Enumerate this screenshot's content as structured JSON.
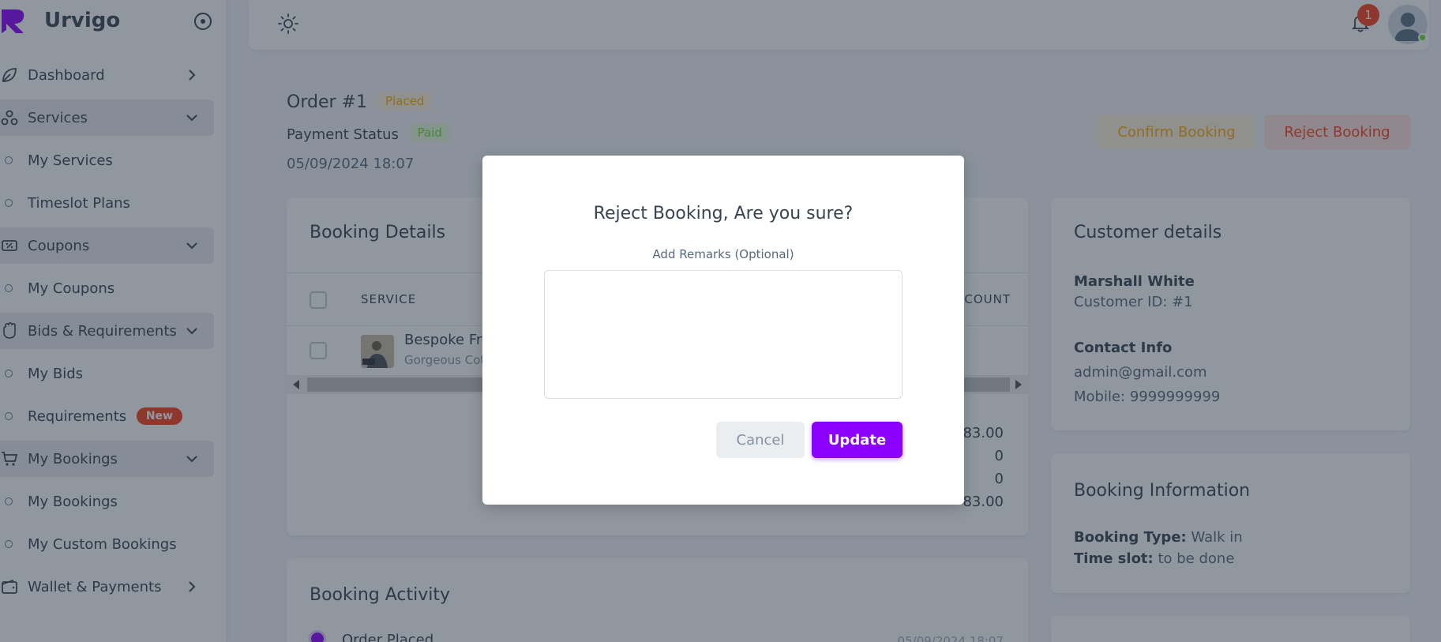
{
  "brand": {
    "name": "Urvigo"
  },
  "sidebar": {
    "items": [
      {
        "type": "menu",
        "label": "Dashboard",
        "icon": "leaf-icon",
        "chevron": "right",
        "open": false
      },
      {
        "type": "menu",
        "label": "Services",
        "icon": "services-icon",
        "chevron": "down",
        "open": true
      },
      {
        "type": "sub",
        "label": "My Services"
      },
      {
        "type": "sub",
        "label": "Timeslot Plans"
      },
      {
        "type": "menu",
        "label": "Coupons",
        "icon": "coupon-icon",
        "chevron": "down",
        "open": true
      },
      {
        "type": "sub",
        "label": "My Coupons"
      },
      {
        "type": "menu",
        "label": "Bids & Requirements",
        "icon": "hand-icon",
        "chevron": "down",
        "open": true
      },
      {
        "type": "sub",
        "label": "My Bids"
      },
      {
        "type": "sub",
        "label": "Requirements",
        "badge": "New"
      },
      {
        "type": "menu",
        "label": "My Bookings",
        "icon": "cart-icon",
        "chevron": "down",
        "open": true
      },
      {
        "type": "sub",
        "label": "My Bookings"
      },
      {
        "type": "sub",
        "label": "My Custom Bookings"
      },
      {
        "type": "menu",
        "label": "Wallet & Payments",
        "icon": "wallet-icon",
        "chevron": "right",
        "open": false
      }
    ]
  },
  "topbar": {
    "notification_count": "1"
  },
  "order": {
    "title": "Order #1",
    "status": "Placed",
    "payment_label": "Payment Status",
    "payment_status": "Paid",
    "date": "05/09/2024 18:07",
    "confirm_label": "Confirm Booking",
    "reject_label": "Reject Booking"
  },
  "booking_details": {
    "title": "Booking Details",
    "col_service": "SERVICE",
    "col_discount": "SCOUNT",
    "row_name": "Bespoke Fr",
    "row_sub": "Gorgeous Cot",
    "totals": [
      "83.00",
      "0",
      "0",
      "83.00"
    ]
  },
  "activity": {
    "title": "Booking Activity",
    "item_label": "Order Placed",
    "item_time": "05/09/2024 18:07"
  },
  "customer": {
    "title": "Customer details",
    "name": "Marshall White",
    "customer_id": "Customer ID: #1",
    "contact_title": "Contact Info",
    "email": "admin@gmail.com",
    "mobile": "Mobile: 9999999999"
  },
  "booking_info": {
    "title": "Booking Information",
    "type_label": "Booking Type:",
    "type_value": " Walk in",
    "slot_label": "Time slot:",
    "slot_value": " to be done"
  },
  "modal": {
    "title": "Reject Booking, Are you sure?",
    "remarks_label": "Add Remarks (Optional)",
    "remarks_value": "",
    "cancel_label": "Cancel",
    "update_label": "Update"
  },
  "colors": {
    "primary": "#8c00ff",
    "danger": "#ff3e1d",
    "warning": "#ffab00",
    "success": "#71dd37"
  }
}
